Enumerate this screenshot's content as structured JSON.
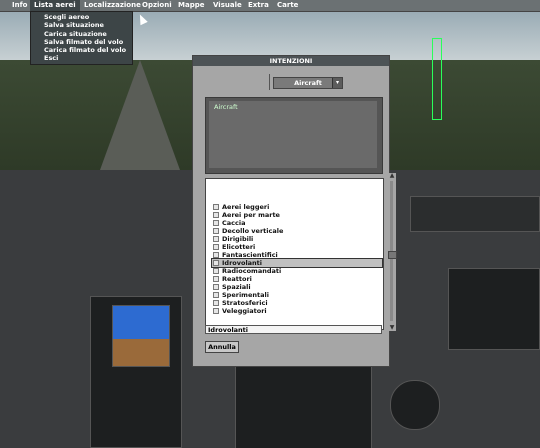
{
  "menubar": {
    "items": [
      "Info",
      "Lista aerei",
      "Localizzazione",
      "Opzioni",
      "Mappe",
      "Visuale",
      "Extra",
      "Carte"
    ],
    "active_index": 1
  },
  "dropdown": {
    "items": [
      "Scegli aereo",
      "Salva situazione",
      "Carica situazione",
      "Salva filmato del volo",
      "Carica filmato del volo",
      "Esci"
    ]
  },
  "dialog": {
    "title": "INTENZIONI",
    "combo_value": "Aircraft",
    "preview_label": "Aircraft",
    "list": [
      "Aerei leggeri",
      "Aerei per marte",
      "Caccia",
      "Decollo verticale",
      "Dirigibili",
      "Elicotteri",
      "Fantascientifici",
      "Idrovolanti",
      "Radiocomandati",
      "Reattori",
      "Spaziali",
      "Sperimentali",
      "Stratosferici",
      "Veleggiatori"
    ],
    "selected_index": 7,
    "field_value": "Idrovolanti",
    "cancel_label": "Annulla"
  }
}
